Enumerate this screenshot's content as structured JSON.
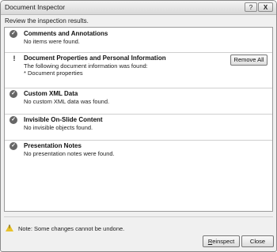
{
  "window": {
    "title": "Document Inspector",
    "help_label": "?",
    "close_label": "X"
  },
  "instruction": "Review the inspection results.",
  "results": [
    {
      "status": "ok",
      "icon": "check-circle-icon",
      "title": "Comments and Annotations",
      "lines": [
        "No items were found."
      ]
    },
    {
      "status": "warning",
      "icon": "exclamation-icon",
      "title": "Document Properties and Personal Information",
      "lines": [
        "The following document information was found:",
        "* Document properties"
      ],
      "action_label": "Remove All"
    },
    {
      "status": "ok",
      "icon": "check-circle-icon",
      "title": "Custom XML Data",
      "lines": [
        "No custom XML data was found."
      ]
    },
    {
      "status": "ok",
      "icon": "check-circle-icon",
      "title": "Invisible On-Slide Content",
      "lines": [
        "No invisible objects found."
      ]
    },
    {
      "status": "ok",
      "icon": "check-circle-icon",
      "title": "Presentation Notes",
      "lines": [
        "No presentation notes were found."
      ]
    }
  ],
  "note": {
    "icon": "warning-triangle-icon",
    "text": "Note: Some changes cannot be undone."
  },
  "buttons": {
    "reinspect_prefix": "R",
    "reinspect_rest": "einspect",
    "close": "Close"
  }
}
